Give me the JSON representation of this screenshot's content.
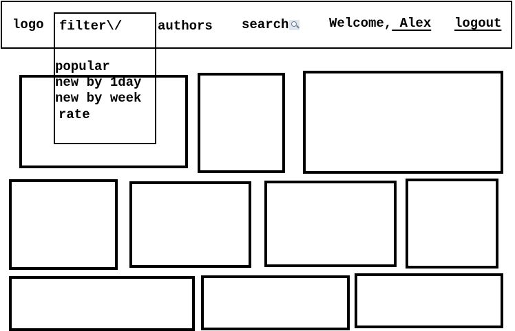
{
  "nav": {
    "logo": "logo",
    "filter": "filter\\/",
    "authors": "authors",
    "search": "search",
    "welcome_prefix": "Welcome,",
    "username": " Alex",
    "logout": "logout"
  },
  "filter_menu": {
    "items": [
      "popular",
      "new by 1day",
      "new by week",
      "rate"
    ]
  },
  "icons": {
    "search": "search-icon"
  }
}
